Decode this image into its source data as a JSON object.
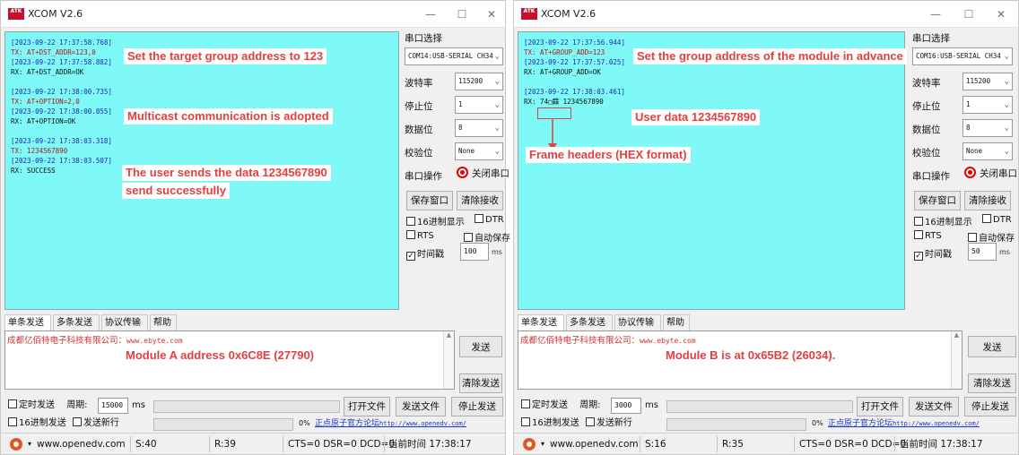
{
  "app": {
    "title": "XCOM V2.6",
    "icon_label": "ATK"
  },
  "side_labels": {
    "port_select": "串口选择",
    "baud": "波特率",
    "stop": "停止位",
    "data": "数据位",
    "parity": "校验位",
    "port_op": "串口操作",
    "close_port": "关闭串口",
    "save_window": "保存窗口",
    "clear_recv": "清除接收",
    "hex_display": "16进制显示",
    "dtr": "DTR",
    "rts": "RTS",
    "auto_save": "自动保存",
    "timestamp": "时间戳",
    "ms": "ms"
  },
  "tabs": [
    "单条发送",
    "多条发送",
    "协议传输",
    "帮助"
  ],
  "send": {
    "content_prefix": "成都亿佰特电子科技有限公司：",
    "content_url": "www.ebyte.com",
    "send_button": "发送",
    "clear_send_button": "清除发送",
    "timed_send": "定时发送",
    "period_label": "周期:",
    "period_unit": "ms",
    "open_file": "打开文件",
    "send_file": "发送文件",
    "stop_send": "停止发送",
    "hex_send": "16进制发送",
    "send_newline": "发送新行",
    "percent": "0%",
    "forum_text": "正点原子官方论坛",
    "forum_url": "http://www.openedv.com/"
  },
  "left": {
    "port": "COM14:USB-SERIAL CH34",
    "baud": "115200",
    "stop": "1",
    "data": "8",
    "parity": "None",
    "timestamp_value": "100",
    "period_value": "15000",
    "log": [
      {
        "kind": "ts",
        "text": "[2023-09-22 17:37:58.768]"
      },
      {
        "kind": "tx",
        "text": "TX: AT+DST_ADDR=123,0"
      },
      {
        "kind": "ts",
        "text": "[2023-09-22 17:37:58.882]"
      },
      {
        "kind": "rx",
        "text": "RX: AT+DST_ADDR=OK"
      },
      {
        "kind": "gap",
        "text": ""
      },
      {
        "kind": "ts",
        "text": "[2023-09-22 17:38:00.735]"
      },
      {
        "kind": "tx",
        "text": "TX: AT+OPTION=2,0"
      },
      {
        "kind": "ts",
        "text": "[2023-09-22 17:38:00.855]"
      },
      {
        "kind": "rx",
        "text": "RX: AT+OPTION=OK"
      },
      {
        "kind": "gap",
        "text": ""
      },
      {
        "kind": "ts",
        "text": "[2023-09-22 17:38:03.318]"
      },
      {
        "kind": "tx",
        "text": "TX: 1234567890"
      },
      {
        "kind": "ts",
        "text": "[2023-09-22 17:38:03.507]"
      },
      {
        "kind": "rx",
        "text": "RX: SUCCESS"
      }
    ],
    "callouts": {
      "target_group": "Set the target group address to 123",
      "multicast": "Multicast communication is adopted",
      "user_sends": "The user sends the data 1234567890",
      "send_success": "send successfully",
      "module_addr": "Module A address 0x6C8E (27790)"
    },
    "status": {
      "website": "www.openedv.com",
      "s": "S:40",
      "r": "R:39",
      "lines": "CTS=0 DSR=0 DCD=0",
      "time": "当前时间 17:38:17"
    }
  },
  "right": {
    "port": "COM16:USB-SERIAL CH34",
    "baud": "115200",
    "stop": "1",
    "data": "8",
    "parity": "None",
    "timestamp_value": "50",
    "period_value": "3000",
    "log": [
      {
        "kind": "ts",
        "text": "[2023-09-22 17:37:56.944]"
      },
      {
        "kind": "tx",
        "text": "TX: AT+GROUP_ADD=123"
      },
      {
        "kind": "ts",
        "text": "[2023-09-22 17:37:57.025]"
      },
      {
        "kind": "rx",
        "text": "RX: AT+GROUP_ADD=OK"
      },
      {
        "kind": "gap",
        "text": ""
      },
      {
        "kind": "ts",
        "text": "[2023-09-22 17:38:03.461]"
      },
      {
        "kind": "rx",
        "text": "RX: 74□蕀 1234567890"
      }
    ],
    "callouts": {
      "group_addr": "Set the group address of the module in advance",
      "user_data": "User data 1234567890",
      "frame_headers": "Frame headers (HEX format)",
      "module_addr": "Module B is at 0x65B2 (26034)."
    },
    "status": {
      "website": "www.openedv.com",
      "s": "S:16",
      "r": "R:35",
      "lines": "CTS=0 DSR=0 DCD=0",
      "time": "当前时间 17:38:17"
    }
  }
}
